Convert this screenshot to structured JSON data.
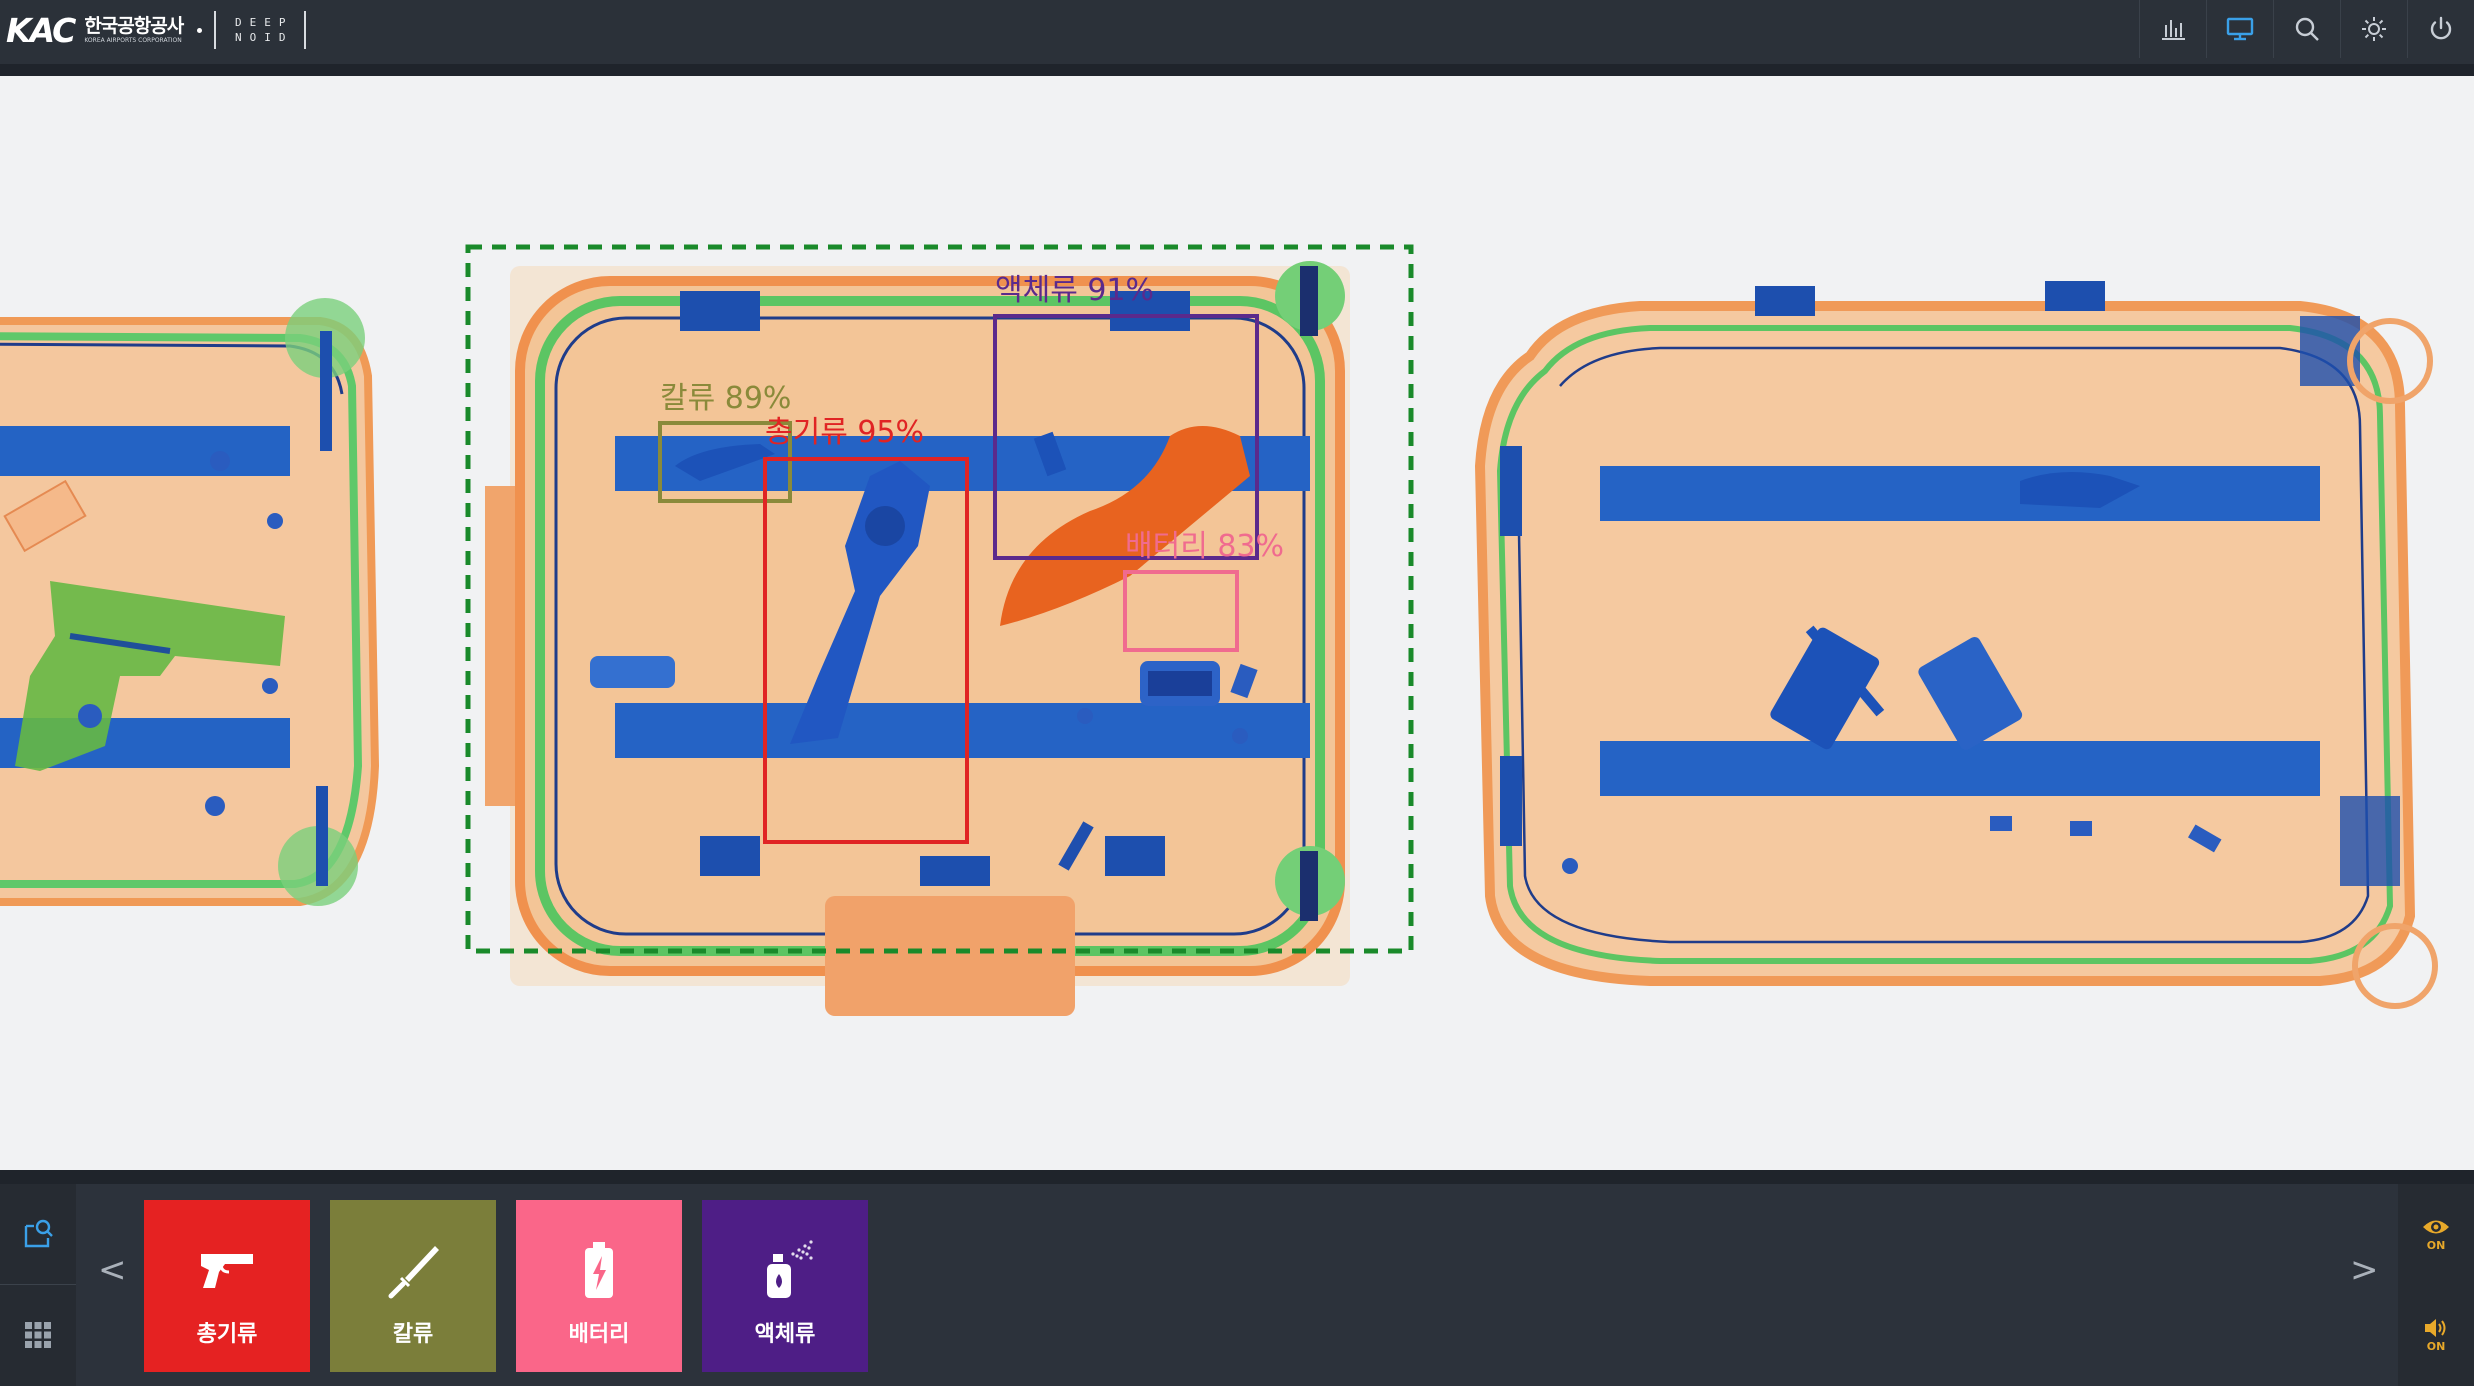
{
  "header": {
    "logo_mark": "KAC",
    "logo_korean": "한국공항공사",
    "logo_english": "KOREA AIRPORTS CORPORATION",
    "partner_logo_line1": "DEEP",
    "partner_logo_line2": "NOID",
    "icons": [
      "statistics-icon",
      "monitor-icon",
      "search-icon",
      "settings-icon",
      "power-icon"
    ]
  },
  "detections": [
    {
      "label": "칼류 89%",
      "color": "#8a8a3a"
    },
    {
      "label": "총기류 95%",
      "color": "#e02424"
    },
    {
      "label": "액체류 91%",
      "color": "#5b2a8c"
    },
    {
      "label": "배터리 83%",
      "color": "#f06b8f"
    }
  ],
  "selection_color": "#1a8a2a",
  "categories": [
    {
      "label": "총기류",
      "icon": "gun-icon",
      "color": "#e52222"
    },
    {
      "label": "칼류",
      "icon": "knife-icon",
      "color": "#7b7e3a"
    },
    {
      "label": "배터리",
      "icon": "battery-icon",
      "color": "#fa6689"
    },
    {
      "label": "액체류",
      "icon": "spray-bottle-icon",
      "color": "#4e1e86"
    }
  ],
  "nav": {
    "prev": "<",
    "next": ">"
  },
  "toggles": {
    "view_state": "ON",
    "sound_state": "ON"
  }
}
